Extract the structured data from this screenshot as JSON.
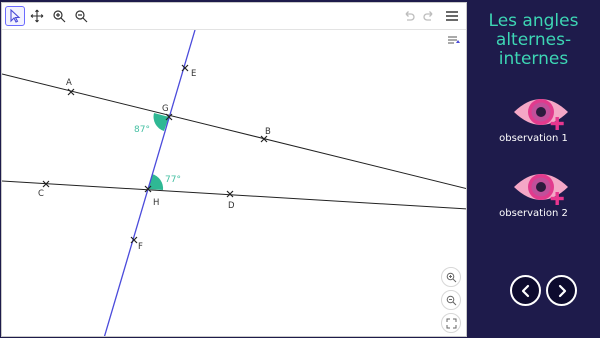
{
  "applet": {
    "tools": [
      {
        "name": "move-tool-icon"
      },
      {
        "name": "pan-tool-icon"
      },
      {
        "name": "zoom-in-tool-icon"
      },
      {
        "name": "zoom-out-tool-icon"
      }
    ],
    "points": {
      "A": "A",
      "B": "B",
      "C": "C",
      "D": "D",
      "E": "E",
      "F": "F",
      "G": "G",
      "H": "H"
    },
    "angles": {
      "at_G": "87°",
      "at_H": "77°"
    },
    "colors": {
      "transversal": "#4b4bdb",
      "lines": "#222222",
      "angle_fill": "#2fb894",
      "angle_label": "#46c0a3"
    }
  },
  "panel": {
    "title_lines": [
      "Les angles",
      "alternes-",
      "internes"
    ],
    "observations": [
      {
        "label": "observation 1",
        "icon": "eye-plus-icon"
      },
      {
        "label": "observation 2",
        "icon": "eye-plus-icon"
      }
    ],
    "nav": {
      "prev_icon": "chevron-left-icon",
      "next_icon": "chevron-right-icon"
    },
    "colors": {
      "background": "#1e1b4b",
      "title": "#3dd6b4",
      "eye_outer": "#f4a7c6",
      "eye_iris": "#e23a8d",
      "plus": "#e8368f"
    }
  }
}
